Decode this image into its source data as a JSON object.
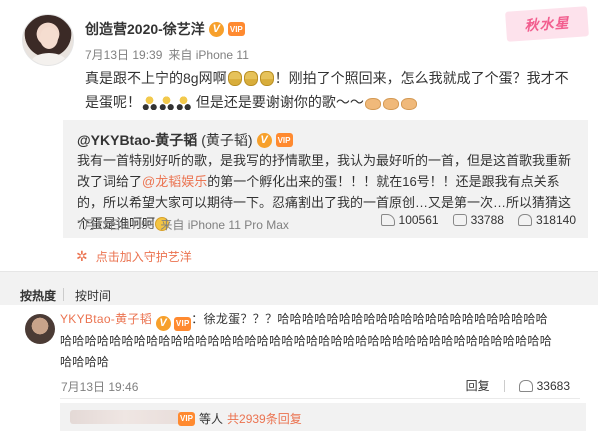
{
  "post": {
    "username": "创造营2020-徐艺洋",
    "date": "7月13日 19:39",
    "source": "来自 iPhone 11",
    "text_part1": "真是跟不上宁的8g网啊",
    "text_part2": "！刚拍了个照回来，怎么我就成了个蛋？我才不是蛋呢！",
    "text_part3": "但是还是要谢谢你的歌～～"
  },
  "logo_text": "秋水星",
  "repost": {
    "username": "@YKYBtao-黄子韬",
    "username_suffix": "(黄子韬)",
    "text_part1": "我有一首特别好听的歌，是我写的抒情歌里，我认为最好听的一首，但是这首歌我重新改了词给了",
    "mention": "@龙韬娱乐",
    "text_part2": "的第一个孵化出来的蛋！！！就在16号！！还是跟我有点关系的，所以希望大家可以期待一下。忍痛割出了我的一首原创…又是第一次…所以猜猜这个蛋是谁呵呵",
    "date": "7月13日 17:53",
    "source": "来自 iPhone 11 Pro Max",
    "shares": "100561",
    "comments": "33788",
    "likes": "318140"
  },
  "guard_link": "点击加入守护艺洋",
  "tabs": {
    "hot": "按热度",
    "time": "按时间"
  },
  "comment": {
    "username": "YKYBtao-黄子韬",
    "text": "：徐龙蛋？？？哈哈哈哈哈哈哈哈哈哈哈哈哈哈哈哈哈哈哈哈哈哈哈哈哈哈哈哈哈哈哈哈哈哈哈哈哈哈哈哈哈哈哈哈哈哈哈哈哈哈哈哈哈哈哈哈哈哈哈哈哈哈哈哈哈哈",
    "date": "7月13日 19:46",
    "reply_label": "回复",
    "likes": "33683"
  },
  "replies": {
    "others": "等人",
    "total": "共2939条回复"
  },
  "colors": {
    "accent": "#eb7350",
    "badge": "#f7a02b",
    "logo_pink": "#f25d8e"
  }
}
